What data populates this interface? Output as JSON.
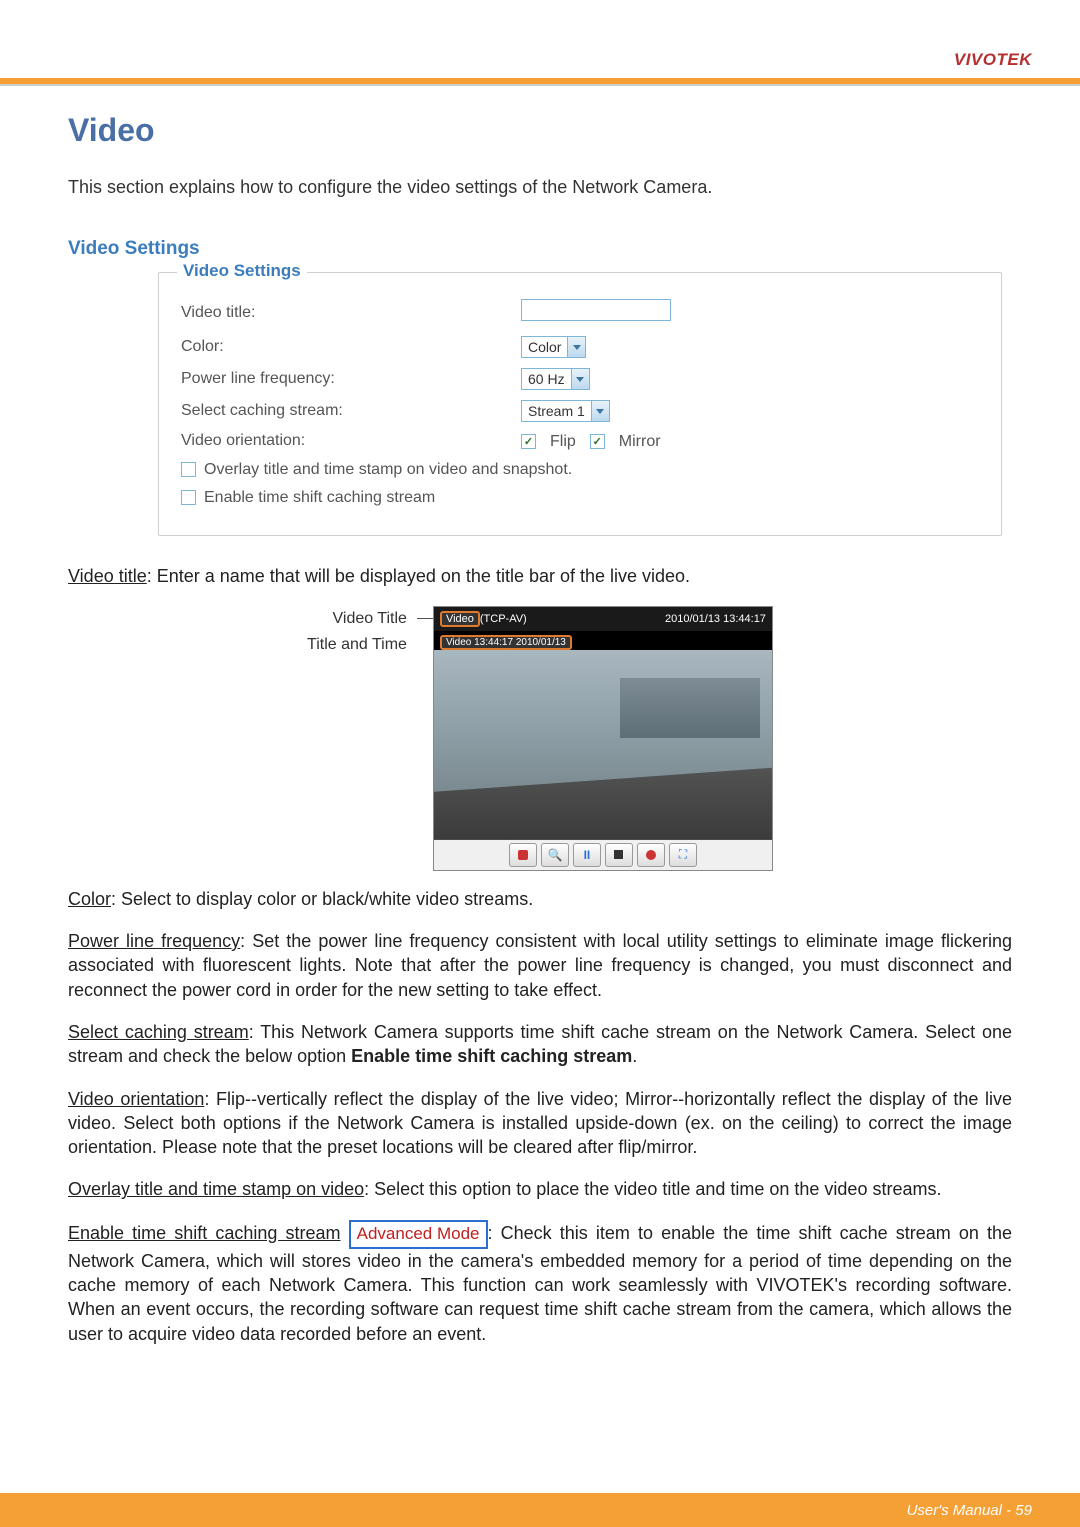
{
  "brand": "VIVOTEK",
  "page": {
    "title": "Video",
    "intro": "This section explains how to configure the video settings of the Network Camera."
  },
  "settings": {
    "subheading": "Video Settings",
    "legend": "Video Settings",
    "rows": {
      "video_title_label": "Video title:",
      "color_label": "Color:",
      "color_value": "Color",
      "power_label": "Power line frequency:",
      "power_value": "60 Hz",
      "caching_label": "Select caching stream:",
      "caching_value": "Stream 1",
      "orientation_label": "Video orientation:",
      "flip_label": "Flip",
      "mirror_label": "Mirror"
    },
    "check_overlay": "Overlay title and time stamp on video and snapshot.",
    "check_timeshift": "Enable time shift caching stream"
  },
  "annotation": {
    "video_title_label": "Video Title",
    "title_time_label": "Title and Time",
    "chip_video": "Video",
    "chip_proto": "(TCP-AV)",
    "chip_timestamp": "2010/01/13 13:44:17",
    "chip_overlay": "Video 13:44:17 2010/01/13"
  },
  "body": {
    "video_title_head": "Video title",
    "video_title_text": ": Enter a name that will be displayed on the title bar of the live video.",
    "color_head": "Color",
    "color_text": ": Select to display color or black/white video streams.",
    "power_head": "Power line frequency",
    "power_text": ": Set the power line frequency consistent with local utility settings to eliminate image flickering associated with fluorescent lights. Note that after the power line frequency is changed, you must disconnect and reconnect the power cord in order for the new setting to take effect.",
    "caching_head": "Select caching stream",
    "caching_text_a": ": This Network Camera supports time shift cache stream on the Network Camera. Select one stream and check the below option ",
    "caching_bold": "Enable time shift caching stream",
    "caching_text_b": ".",
    "orientation_head": "Video orientation",
    "orientation_text": ": Flip--vertically reflect the display of the live video; Mirror--horizontally reflect the display of the live video. Select both options if the Network Camera is installed upside-down (ex. on the ceiling) to correct the image orientation.  Please note that the preset locations will be cleared after flip/mirror.",
    "overlay_head": "Overlay title and time stamp on video",
    "overlay_text": ": Select this option to place the video title and time on the video streams.",
    "timeshift_head": "Enable time shift caching stream",
    "adv_mode": "Advanced Mode",
    "timeshift_text": ": Check this item to enable the time shift cache stream on the Network Camera, which will stores video in the camera's embedded memory for a period of time depending on the cache memory of each Network Camera. This function can work seamlessly with VIVOTEK's recording software. When an event occurs, the recording software can request time shift cache stream from the camera, which allows the user to acquire video data recorded before an event."
  },
  "footer": "User's Manual - 59"
}
